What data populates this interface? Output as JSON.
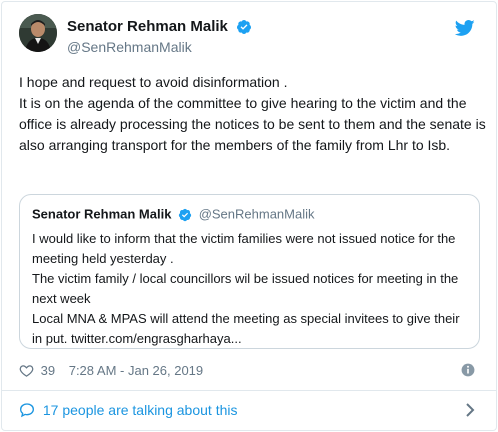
{
  "author": {
    "display_name": "Senator Rehman Malik",
    "handle": "@SenRehmanMalik"
  },
  "tweet": {
    "paragraphs": [
      "I hope and request to avoid disinformation .",
      "It is on the agenda of the committee to give hearing to the victim and the office is already processing the notices to be sent to them and the senate is also arranging transport for the members of the family from Lhr to Isb."
    ]
  },
  "quoted_tweet": {
    "display_name": "Senator Rehman Malik",
    "handle": "@SenRehmanMalik",
    "lines": [
      "I would like to inform that the victim families were not issued notice for the meeting held yesterday .",
      "The victim family / local councillors wil be issued notices  for meeting in the next week",
      "Local MNA & MPAS will attend the meeting as special invitees to give their in put. twitter.com/engrasgharhaya..."
    ]
  },
  "meta": {
    "likes": "39",
    "timestamp": "7:28 AM - Jan 26, 2019"
  },
  "conversation": {
    "label": "17 people are talking about this"
  },
  "colors": {
    "verified_blue": "#1da1f2",
    "link_blue": "#1b95e0",
    "secondary_text": "#657786"
  },
  "icons": {
    "brand": "twitter-bird-icon",
    "verified": "verified-badge-icon",
    "like": "heart-icon",
    "info": "info-icon",
    "reply": "speech-bubble-icon",
    "expand": "chevron-right-icon"
  }
}
